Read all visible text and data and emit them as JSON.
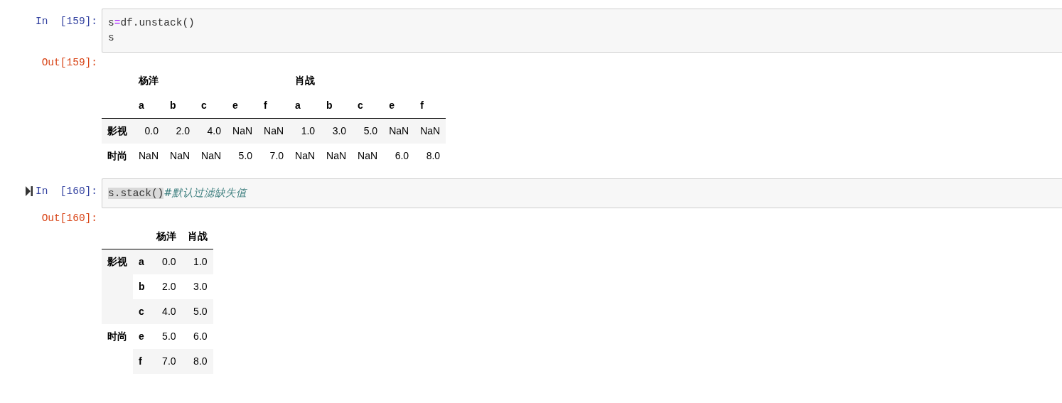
{
  "cells": [
    {
      "in_prompt": "In  [159]:",
      "selected": false,
      "code_lines": [
        [
          {
            "kind": "name",
            "text": "s"
          },
          {
            "kind": "operator",
            "text": "="
          },
          {
            "kind": "name",
            "text": "df.unstack()"
          }
        ],
        [
          {
            "kind": "name",
            "text": "s"
          }
        ]
      ],
      "out_prompt": "Out[159]:",
      "output": {
        "kind": "wide",
        "column_groups": [
          {
            "label": "杨洋",
            "columns": [
              "a",
              "b",
              "c",
              "e",
              "f"
            ]
          },
          {
            "label": "肖战",
            "columns": [
              "a",
              "b",
              "c",
              "e",
              "f"
            ]
          }
        ],
        "rows": [
          {
            "index": "影视",
            "values": [
              "0.0",
              "2.0",
              "4.0",
              "NaN",
              "NaN",
              "1.0",
              "3.0",
              "5.0",
              "NaN",
              "NaN"
            ]
          },
          {
            "index": "时尚",
            "values": [
              "NaN",
              "NaN",
              "NaN",
              "5.0",
              "7.0",
              "NaN",
              "NaN",
              "NaN",
              "6.0",
              "8.0"
            ]
          }
        ]
      }
    },
    {
      "in_prompt": "In  [160]:",
      "selected": true,
      "code_lines": [
        [
          {
            "kind": "highlight",
            "text": "s.stack()"
          },
          {
            "kind": "comment",
            "text": "#默认过滤缺失值"
          }
        ]
      ],
      "out_prompt": "Out[160]:",
      "output": {
        "kind": "long",
        "columns": [
          "杨洋",
          "肖战"
        ],
        "groups": [
          {
            "index": "影视",
            "rows": [
              {
                "key": "a",
                "values": [
                  "0.0",
                  "1.0"
                ]
              },
              {
                "key": "b",
                "values": [
                  "2.0",
                  "3.0"
                ]
              },
              {
                "key": "c",
                "values": [
                  "4.0",
                  "5.0"
                ]
              }
            ]
          },
          {
            "index": "时尚",
            "rows": [
              {
                "key": "e",
                "values": [
                  "5.0",
                  "6.0"
                ]
              },
              {
                "key": "f",
                "values": [
                  "7.0",
                  "8.0"
                ]
              }
            ]
          }
        ]
      }
    }
  ]
}
